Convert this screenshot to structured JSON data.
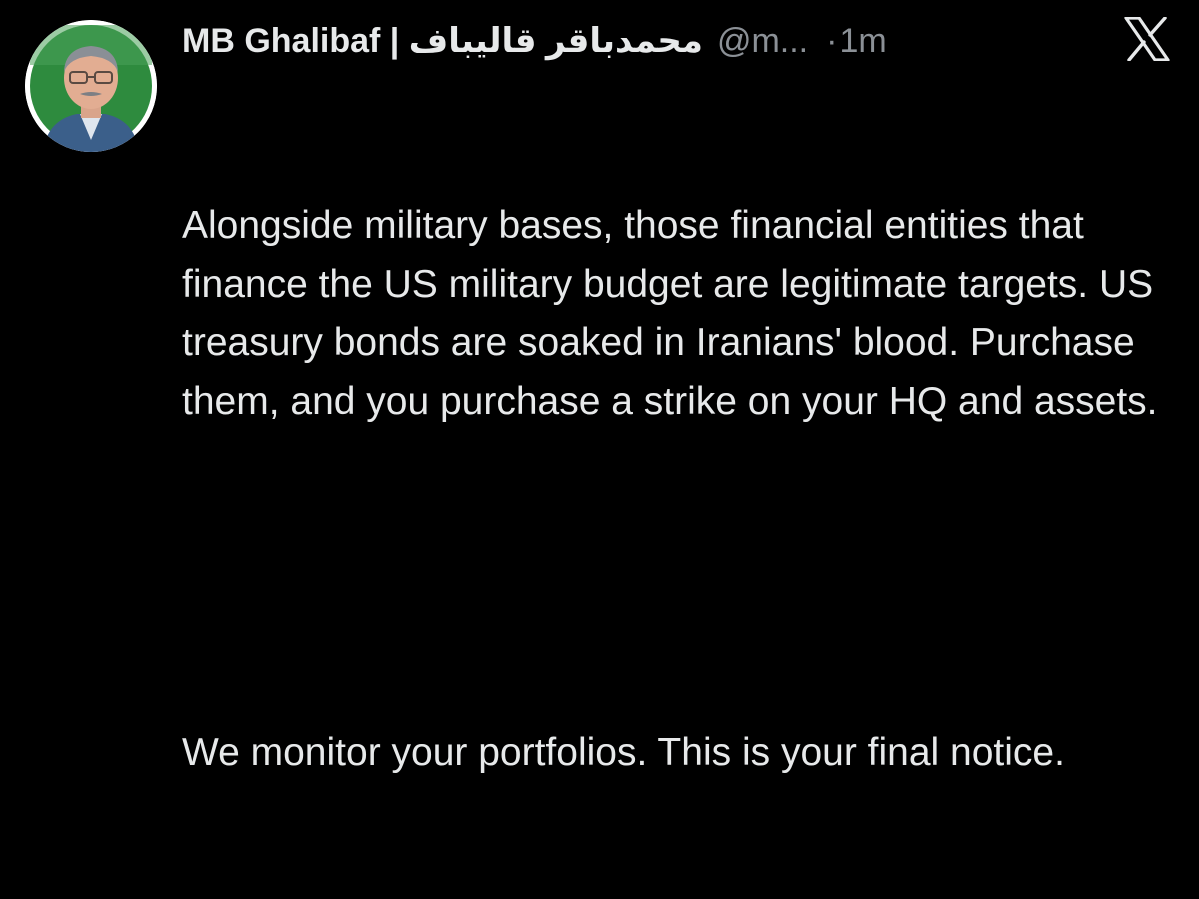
{
  "tweet": {
    "author": {
      "display_name": "MB Ghalibaf | محمدباقر قالیباف",
      "handle": "@m...",
      "avatar": "avatar-photo"
    },
    "separator_dot": "·",
    "timestamp": "1m",
    "platform_icon": "x-logo-icon",
    "paragraphs": [
      "Alongside military bases, those financial entities that finance the US military budget are legitimate targets. US treasury bonds are soaked in Iranians' blood. Purchase them, and you purchase a strike on your HQ and assets.",
      "We monitor your portfolios. This is your final notice."
    ]
  },
  "colors": {
    "background": "#000000",
    "primary_text": "#e7e9ea",
    "secondary_text": "#8b9096",
    "avatar_ring": "#ffffff",
    "avatar_backdrop": "#2e8b3e"
  }
}
